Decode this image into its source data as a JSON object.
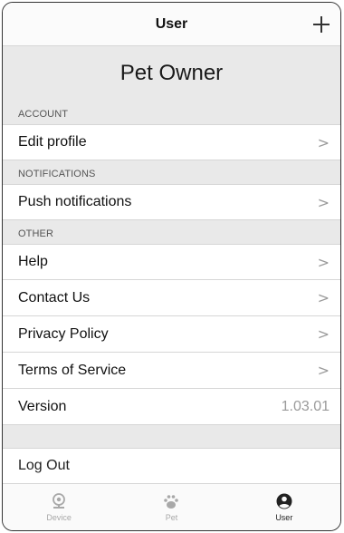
{
  "header": {
    "title": "User",
    "add_icon": "plus-icon"
  },
  "owner": {
    "name": "Pet Owner"
  },
  "sections": {
    "account": {
      "title": "ACCOUNT",
      "items": [
        {
          "label": "Edit profile"
        }
      ]
    },
    "notifications": {
      "title": "NOTIFICATIONS",
      "items": [
        {
          "label": "Push notifications"
        }
      ]
    },
    "other": {
      "title": "OTHER",
      "items": [
        {
          "label": "Help"
        },
        {
          "label": "Contact Us"
        },
        {
          "label": "Privacy Policy"
        },
        {
          "label": "Terms of Service"
        }
      ],
      "version_label": "Version",
      "version_value": "1.03.01"
    }
  },
  "chevron": ">",
  "logout": {
    "label": "Log Out"
  },
  "tabs": [
    {
      "label": "Device",
      "icon": "webcam-icon",
      "active": false
    },
    {
      "label": "Pet",
      "icon": "paw-icon",
      "active": false
    },
    {
      "label": "User",
      "icon": "user-circle-icon",
      "active": true
    }
  ],
  "colors": {
    "accent": "#222222",
    "inactive": "#a8a8a8",
    "background": "#e9e9e9"
  }
}
